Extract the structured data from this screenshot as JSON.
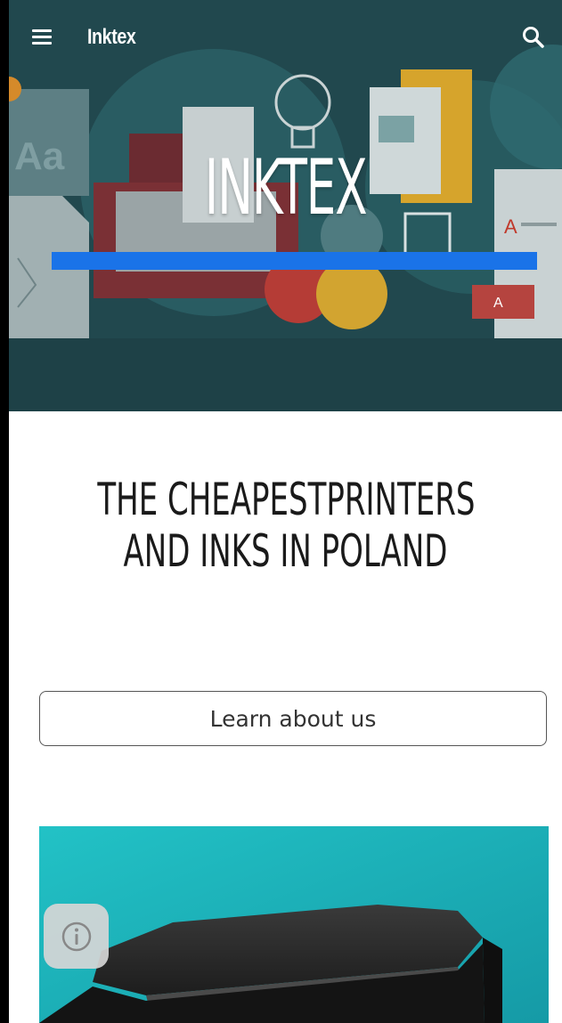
{
  "appbar": {
    "brand": "Inktex",
    "menu_icon": "hamburger-menu-icon",
    "search_icon": "search-icon"
  },
  "hero": {
    "title": "INKTEX",
    "accent_color": "#1a73e8",
    "background_color": "#21484e"
  },
  "headline": {
    "line1": "THE CHEAPESTPRINTERS",
    "line2": "AND INKS IN POLAND"
  },
  "cta": {
    "label": "Learn about us"
  },
  "product": {
    "background_color": "#1fb7bf",
    "info_icon": "info-icon"
  }
}
